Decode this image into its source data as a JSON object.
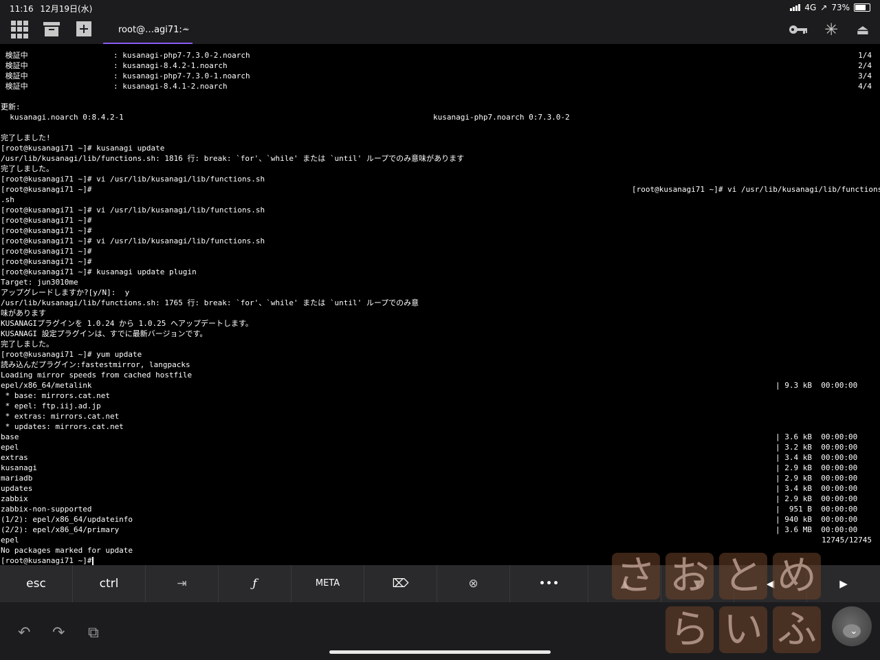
{
  "status_bar": {
    "time": "11:16",
    "date": "12月19日(水)",
    "network": "4G",
    "location": "↗",
    "battery": "73%"
  },
  "toolbar": {
    "tab_title": "root@…agi71:~",
    "tab_chevron": "⌄"
  },
  "icons": [
    "grid-icon",
    "archive-icon",
    "plus-icon",
    "key-icon",
    "sparkle-icon",
    "eject-icon"
  ],
  "terminal": {
    "verify": [
      {
        "label": " 検証中",
        "pkg": ": kusanagi-php7-7.3.0-2.noarch",
        "count": "1/4"
      },
      {
        "label": " 検証中",
        "pkg": ": kusanagi-8.4.2-1.noarch",
        "count": "2/4"
      },
      {
        "label": " 検証中",
        "pkg": ": kusanagi-php7-7.3.0-1.noarch",
        "count": "3/4"
      },
      {
        "label": " 検証中",
        "pkg": ": kusanagi-8.4.1-2.noarch",
        "count": "4/4"
      }
    ],
    "updated_header": "更新:",
    "updated_left": "  kusanagi.noarch 0:8.4.2-1",
    "updated_right": "kusanagi-php7.noarch 0:7.3.0-2",
    "lines": [
      "完了しました!",
      "[root@kusanagi71 ~]# kusanagi update",
      "/usr/lib/kusanagi/lib/functions.sh: 1816 行: break: `for'、`while' または `until' ループでのみ意味があります",
      "完了しました。",
      "[root@kusanagi71 ~]# vi /usr/lib/kusanagi/lib/functions.sh",
      "[root@kusanagi71 ~]#",
      ".sh",
      "[root@kusanagi71 ~]# vi /usr/lib/kusanagi/lib/functions.sh",
      "[root@kusanagi71 ~]#",
      "[root@kusanagi71 ~]#",
      "[root@kusanagi71 ~]# vi /usr/lib/kusanagi/lib/functions.sh",
      "[root@kusanagi71 ~]#",
      "[root@kusanagi71 ~]#",
      "[root@kusanagi71 ~]# kusanagi update plugin",
      "Target: jun3010me",
      "アップグレードしますか?[y/N]:  y",
      "/usr/lib/kusanagi/lib/functions.sh: 1765 行: break: `for'、`while' または `until' ループでのみ意",
      "味があります",
      "KUSANAGIプラグインを 1.0.24 から 1.0.25 へアップデートします。",
      "KUSANAGI 設定プラグインは、すでに最新バージョンです。",
      "完了しました。",
      "[root@kusanagi71 ~]# yum update",
      "読み込んだプラグイン:fastestmirror, langpacks",
      "Loading mirror speeds from cached hostfile",
      "epel/x86_64/metalink",
      " * base: mirrors.cat.net",
      " * epel: ftp.iij.ad.jp",
      " * extras: mirrors.cat.net",
      " * updates: mirrors.cat.net",
      "base",
      "epel",
      "extras",
      "kusanagi",
      "mariadb",
      "updates",
      "zabbix",
      "zabbix-non-supported",
      "(1/2): epel/x86_64/updateinfo",
      "(2/2): epel/x86_64/primary",
      "epel",
      "No packages marked for update",
      "[root@kusanagi71 ~]#"
    ],
    "wrapped_right": "[root@kusanagi71 ~]# vi /usr/lib/kusanagi/lib/functions",
    "repo_stats": [
      "| 9.3 kB  00:00:00",
      "| 3.6 kB  00:00:00",
      "| 3.2 kB  00:00:00",
      "| 3.4 kB  00:00:00",
      "| 2.9 kB  00:00:00",
      "| 2.9 kB  00:00:00",
      "| 3.4 kB  00:00:00",
      "| 2.9 kB  00:00:00",
      "|  951 B  00:00:00",
      "| 940 kB  00:00:00",
      "| 3.6 MB  00:00:00"
    ],
    "epel_count": "12745/12745"
  },
  "keybar": {
    "keys": [
      "esc",
      "ctrl",
      "⇥",
      "ƒ",
      "META",
      "⌦",
      "⊗",
      "•••"
    ],
    "arrows": [
      "▲",
      "▼",
      "◀",
      "▶"
    ]
  },
  "bottom": {
    "undo": "↶",
    "redo": "↷",
    "copy": "⧉",
    "hide_keyboard": "⌄"
  },
  "watermark": {
    "row1": [
      "さ",
      "お",
      "と",
      "め"
    ],
    "row2": [
      "ら",
      "い",
      "ふ"
    ]
  }
}
